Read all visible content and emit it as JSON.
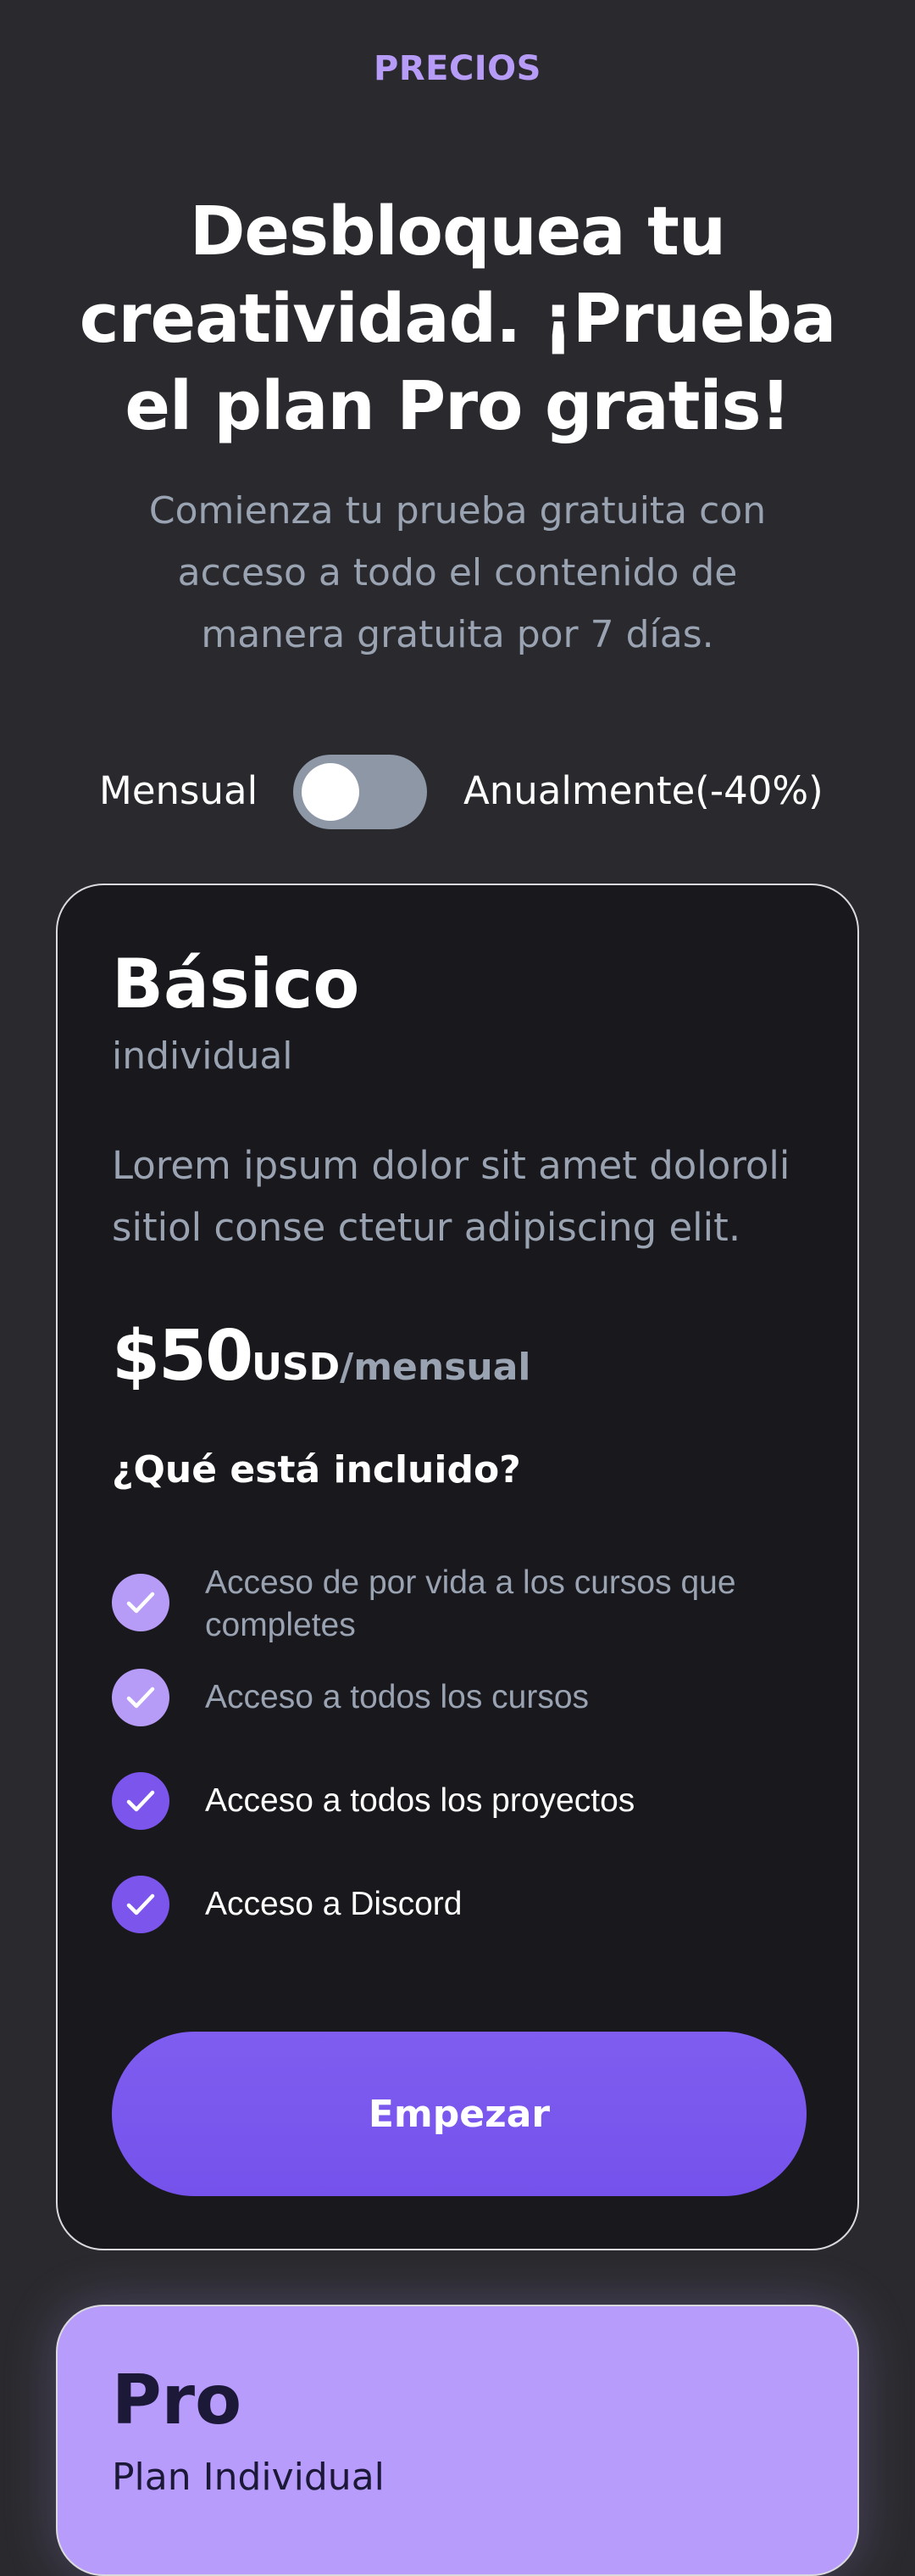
{
  "header": {
    "eyebrow": "PRECIOS",
    "title": "Desbloquea tu creatividad. ¡Prueba el plan Pro gratis!",
    "subtitle": "Comienza tu prueba gratuita con acceso a todo el contenido de manera gratuita por 7 días."
  },
  "billing_toggle": {
    "monthly_label": "Mensual",
    "yearly_label": "Anualmente(-40%)",
    "yearly_selected": false
  },
  "plans": [
    {
      "name": "Básico",
      "audience": "individual",
      "description": "Lorem ipsum dolor sit amet doloroli sitiol conse ctetur adipiscing elit.",
      "price": "$50",
      "currency": "USD",
      "period": "/mensual",
      "included_title": "¿Qué está incluido?",
      "features": [
        {
          "text": "Acceso de por vida a los cursos que completes",
          "highlighted": false
        },
        {
          "text": "Acceso a todos los cursos",
          "highlighted": false
        },
        {
          "text": "Acceso a todos los proyectos",
          "highlighted": true
        },
        {
          "text": "Acceso a Discord",
          "highlighted": true
        }
      ],
      "cta_label": "Empezar"
    },
    {
      "name": "Pro",
      "audience": "Plan Individual"
    }
  ],
  "colors": {
    "background": "#2a2a2e",
    "card_dark": "#19181d",
    "accent": "#7b55ec",
    "accent_light": "#b69cf7",
    "muted_text": "#9aa3b2",
    "pro_card": "#b89cfb"
  }
}
